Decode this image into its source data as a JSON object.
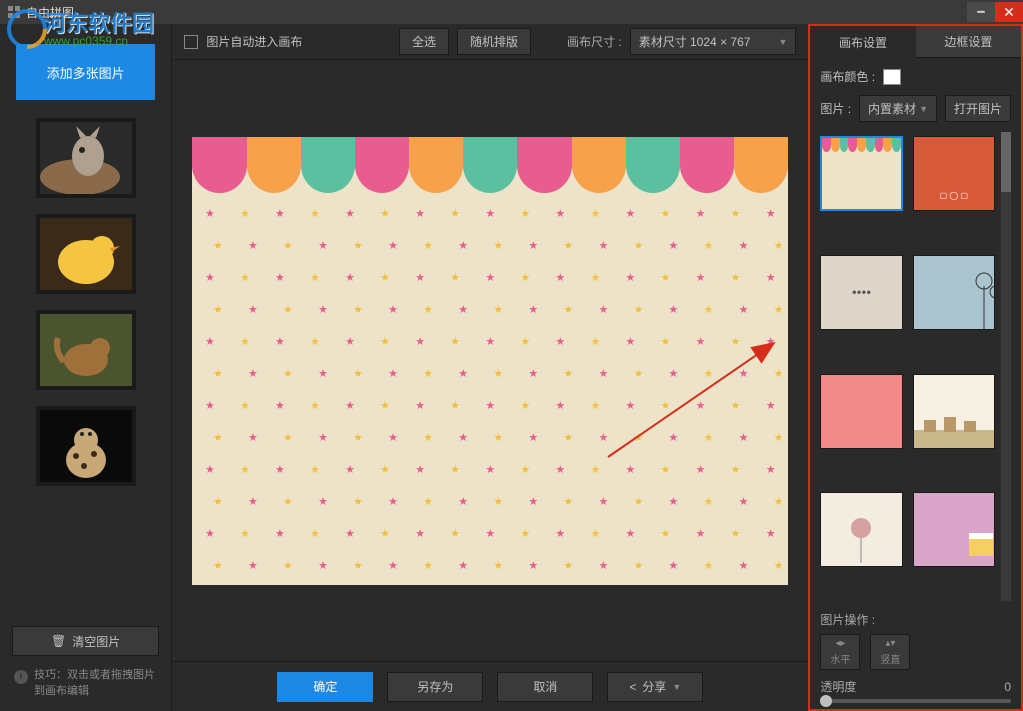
{
  "window": {
    "title": "自由拼图"
  },
  "watermark": {
    "line1": "河东软件园",
    "line2": "www.pc0359.cn"
  },
  "left": {
    "add_label": "添加多张图片",
    "clear_label": "清空图片",
    "tip_label": "技巧：双击或者拖拽图片到画布编辑"
  },
  "toolbar": {
    "auto_label": "图片自动进入画布",
    "select_all": "全选",
    "random": "随机排版",
    "size_label": "画布尺寸 :",
    "size_value": "素材尺寸 1024 × 767"
  },
  "bottom": {
    "ok": "确定",
    "save_as": "另存为",
    "cancel": "取消",
    "share": "分享"
  },
  "right": {
    "tab_canvas": "画布设置",
    "tab_border": "边框设置",
    "color_label": "画布颜色 :",
    "pic_label": "图片 :",
    "pic_value": "内置素材",
    "open_pic": "打开图片",
    "ops_label": "图片操作 :",
    "flip_h": "水平",
    "flip_v": "竖直",
    "opacity_label": "透明度",
    "opacity_value": "0"
  },
  "scallop_colors": [
    "#e85c8f",
    "#f7a14a",
    "#5cbfa0",
    "#e85c8f",
    "#f7a14a",
    "#5cbfa0",
    "#e85c8f",
    "#f7a14a",
    "#5cbfa0",
    "#e85c8f",
    "#f7a14a"
  ],
  "star_colors": [
    "#e85c8f",
    "#f0c040"
  ],
  "materials": [
    {
      "bg": "#ede3c9",
      "selected": true,
      "type": "dots"
    },
    {
      "bg": "#d85a3a",
      "selected": false,
      "type": "orange"
    },
    {
      "bg": "#ddd6c9",
      "selected": false,
      "type": "stick"
    },
    {
      "bg": "#a9c4cf",
      "selected": false,
      "type": "dandelion"
    },
    {
      "bg": "#f28a8a",
      "selected": false,
      "type": "pink"
    },
    {
      "bg": "#f5f0e1",
      "selected": false,
      "type": "village"
    },
    {
      "bg": "#f2ede0",
      "selected": false,
      "type": "tree"
    },
    {
      "bg": "#d9a6c9",
      "selected": false,
      "type": "cake"
    }
  ]
}
